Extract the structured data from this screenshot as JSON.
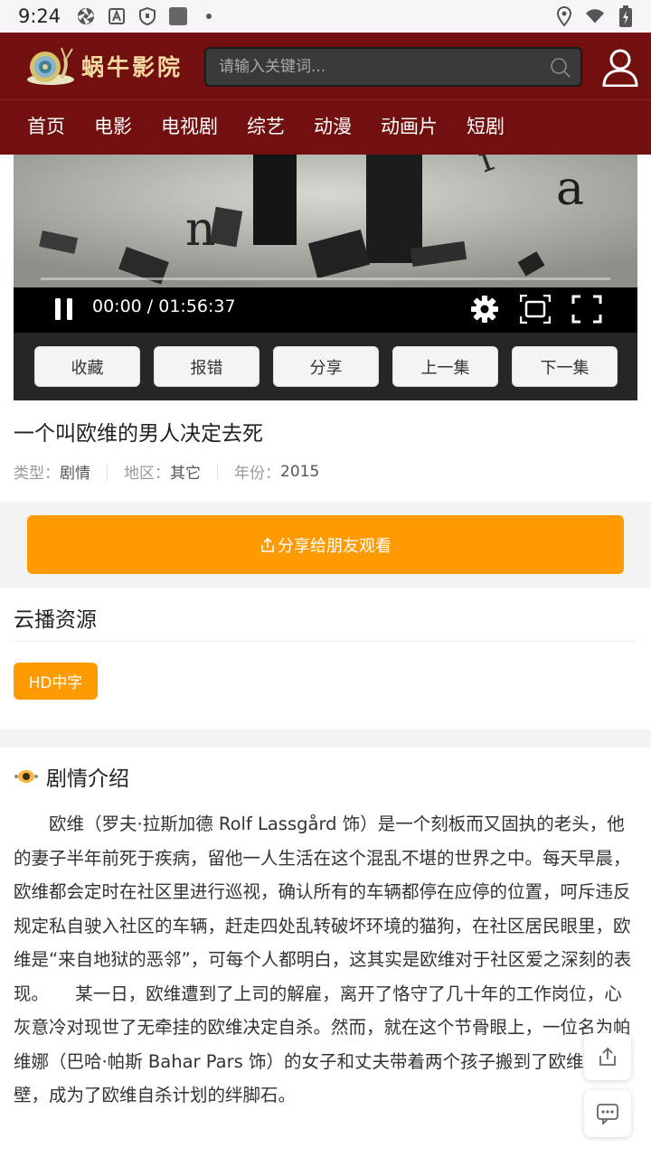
{
  "status_bar": {
    "time": "9:24"
  },
  "header": {
    "logo_text": "蜗牛影院",
    "search_placeholder": "请输入关键词...",
    "nav": [
      "首页",
      "电影",
      "电视剧",
      "综艺",
      "动漫",
      "动画片",
      "短剧"
    ]
  },
  "player": {
    "time_display": "00:00 / 01:56:37",
    "actions": [
      "收藏",
      "报错",
      "分享",
      "上一集",
      "下一集"
    ]
  },
  "movie": {
    "title": "一个叫欧维的男人决定去死",
    "type_label": "类型：",
    "type_value": "剧情",
    "region_label": "地区：",
    "region_value": "其它",
    "year_label": "年份：",
    "year_value": "2015"
  },
  "share": {
    "label": "分享给朋友观看"
  },
  "sources": {
    "title": "云播资源",
    "tags": [
      "HD中字"
    ]
  },
  "plot": {
    "title": "剧情介绍",
    "text": "欧维（罗夫·拉斯加德 Rolf Lassgård 饰）是一个刻板而又固执的老头，他的妻子半年前死于疾病，留他一人生活在这个混乱不堪的世界之中。每天早晨，欧维都会定时在社区里进行巡视，确认所有的车辆都停在应停的位置，呵斥违反规定私自驶入社区的车辆，赶走四处乱转破坏环境的猫狗，在社区居民眼里，欧维是“来自地狱的恶邻”，可每个人都明白，这其实是欧维对于社区爱之深刻的表现。　　某一日，欧维遭到了上司的解雇，离开了恪守了几十年的工作岗位，心灰意冷对现世了无牵挂的欧维决定自杀。然而，就在这个节骨眼上，一位名为帕维娜（巴哈·帕斯 Bahar Pars 饰）的女子和丈夫带着两个孩子搬到了欧维的隔壁，成为了欧维自杀计划的绊脚石。"
  }
}
